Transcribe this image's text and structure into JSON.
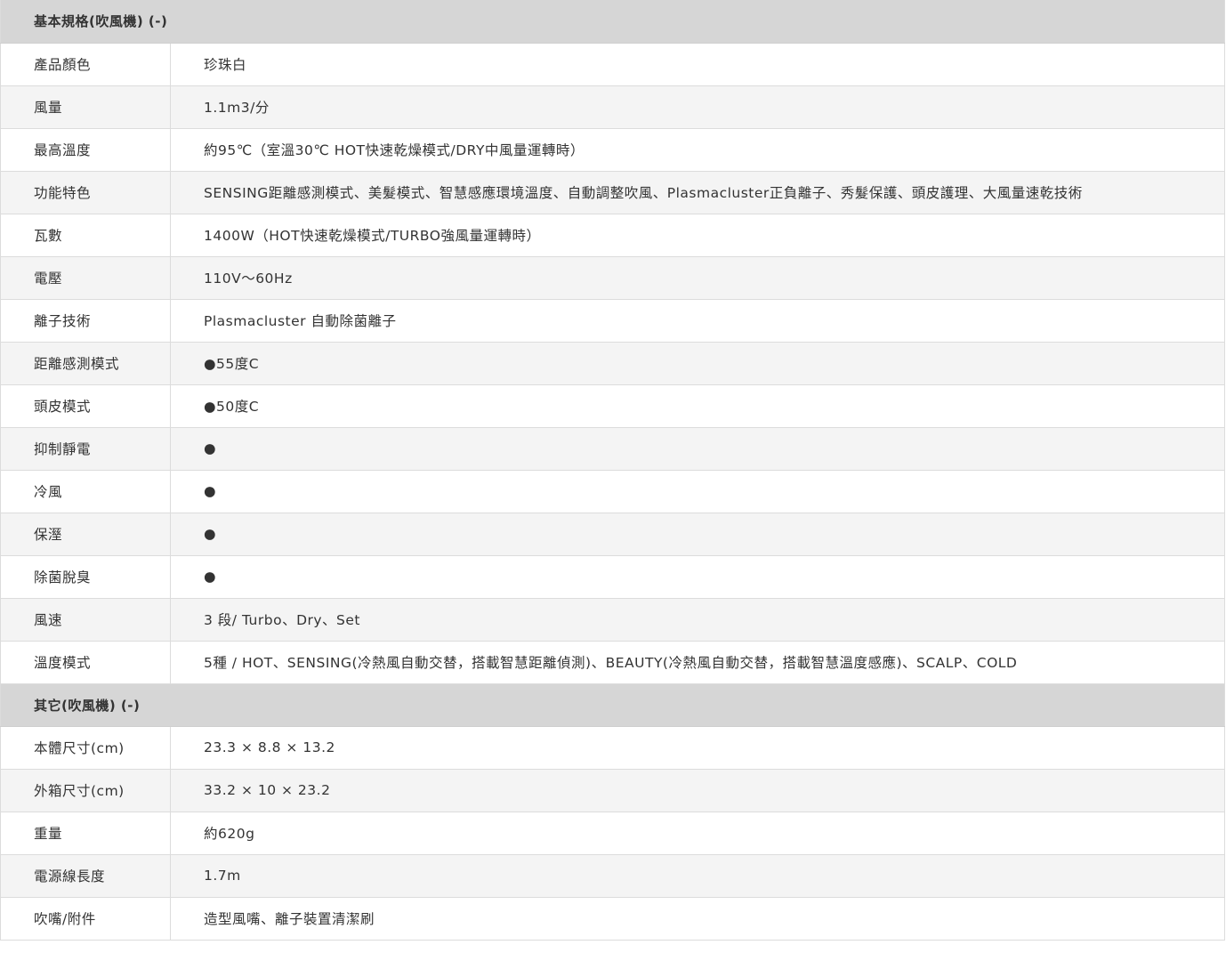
{
  "sections": [
    {
      "title": "基本規格(吹風機) (-)",
      "rows": [
        {
          "label": "產品顏色",
          "value": "珍珠白"
        },
        {
          "label": "風量",
          "value": "1.1m3/分"
        },
        {
          "label": "最高溫度",
          "value": "約95℃（室溫30℃ HOT快速乾燥模式/DRY中風量運轉時）"
        },
        {
          "label": "功能特色",
          "value": "SENSING距離感測模式、美髮模式、智慧感應環境溫度、自動調整吹風、Plasmacluster正負離子、秀髮保護、頭皮護理、大風量速乾技術"
        },
        {
          "label": "瓦數",
          "value": "1400W（HOT快速乾燥模式/TURBO強風量運轉時）"
        },
        {
          "label": "電壓",
          "value": "110V～60Hz"
        },
        {
          "label": "離子技術",
          "value": "Plasmacluster 自動除菌離子"
        },
        {
          "label": "距離感測模式",
          "value": "●55度C"
        },
        {
          "label": "頭皮模式",
          "value": "●50度C"
        },
        {
          "label": "抑制靜電",
          "value": "●"
        },
        {
          "label": "冷風",
          "value": "●"
        },
        {
          "label": "保溼",
          "value": "●"
        },
        {
          "label": "除菌脫臭",
          "value": "●"
        },
        {
          "label": "風速",
          "value": "3 段/ Turbo、Dry、Set"
        },
        {
          "label": "溫度模式",
          "value": "5種 / HOT、SENSING(冷熱風自動交替，搭載智慧距離偵測)、BEAUTY(冷熱風自動交替，搭載智慧溫度感應)、SCALP、COLD"
        }
      ]
    },
    {
      "title": "其它(吹風機) (-)",
      "rows": [
        {
          "label": "本體尺寸(cm)",
          "value": "23.3 × 8.8 × 13.2"
        },
        {
          "label": "外箱尺寸(cm)",
          "value": "33.2 × 10 × 23.2"
        },
        {
          "label": "重量",
          "value": "約620g"
        },
        {
          "label": "電源線長度",
          "value": "1.7m"
        },
        {
          "label": "吹嘴/附件",
          "value": "造型風嘴、離子裝置清潔刷"
        }
      ]
    }
  ]
}
